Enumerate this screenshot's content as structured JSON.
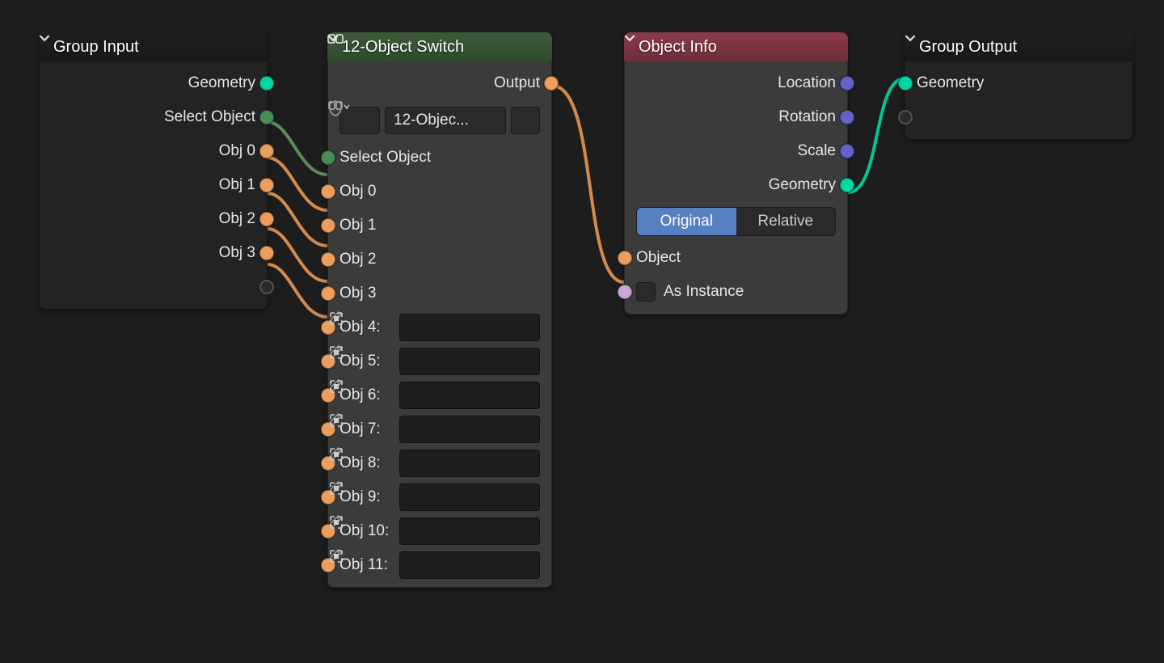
{
  "nodes": {
    "group_input": {
      "title": "Group Input",
      "outs": [
        "Geometry",
        "Select Object",
        "Obj 0",
        "Obj 1",
        "Obj 2",
        "Obj 3"
      ]
    },
    "switch": {
      "title": "12-Object Switch",
      "group_name": "12-Objec...",
      "out": "Output",
      "ins_linked": [
        "Select Object",
        "Obj 0",
        "Obj 1",
        "Obj 2",
        "Obj 3"
      ],
      "ins_widget": [
        "Obj 4:",
        "Obj 5:",
        "Obj 6:",
        "Obj 7:",
        "Obj 8:",
        "Obj 9:",
        "Obj 10:",
        "Obj 11:"
      ]
    },
    "object_info": {
      "title": "Object Info",
      "outs": [
        "Location",
        "Rotation",
        "Scale",
        "Geometry"
      ],
      "mode": {
        "a": "Original",
        "b": "Relative"
      },
      "in_obj": "Object",
      "in_inst": "As Instance"
    },
    "group_output": {
      "title": "Group Output",
      "in": "Geometry"
    }
  }
}
